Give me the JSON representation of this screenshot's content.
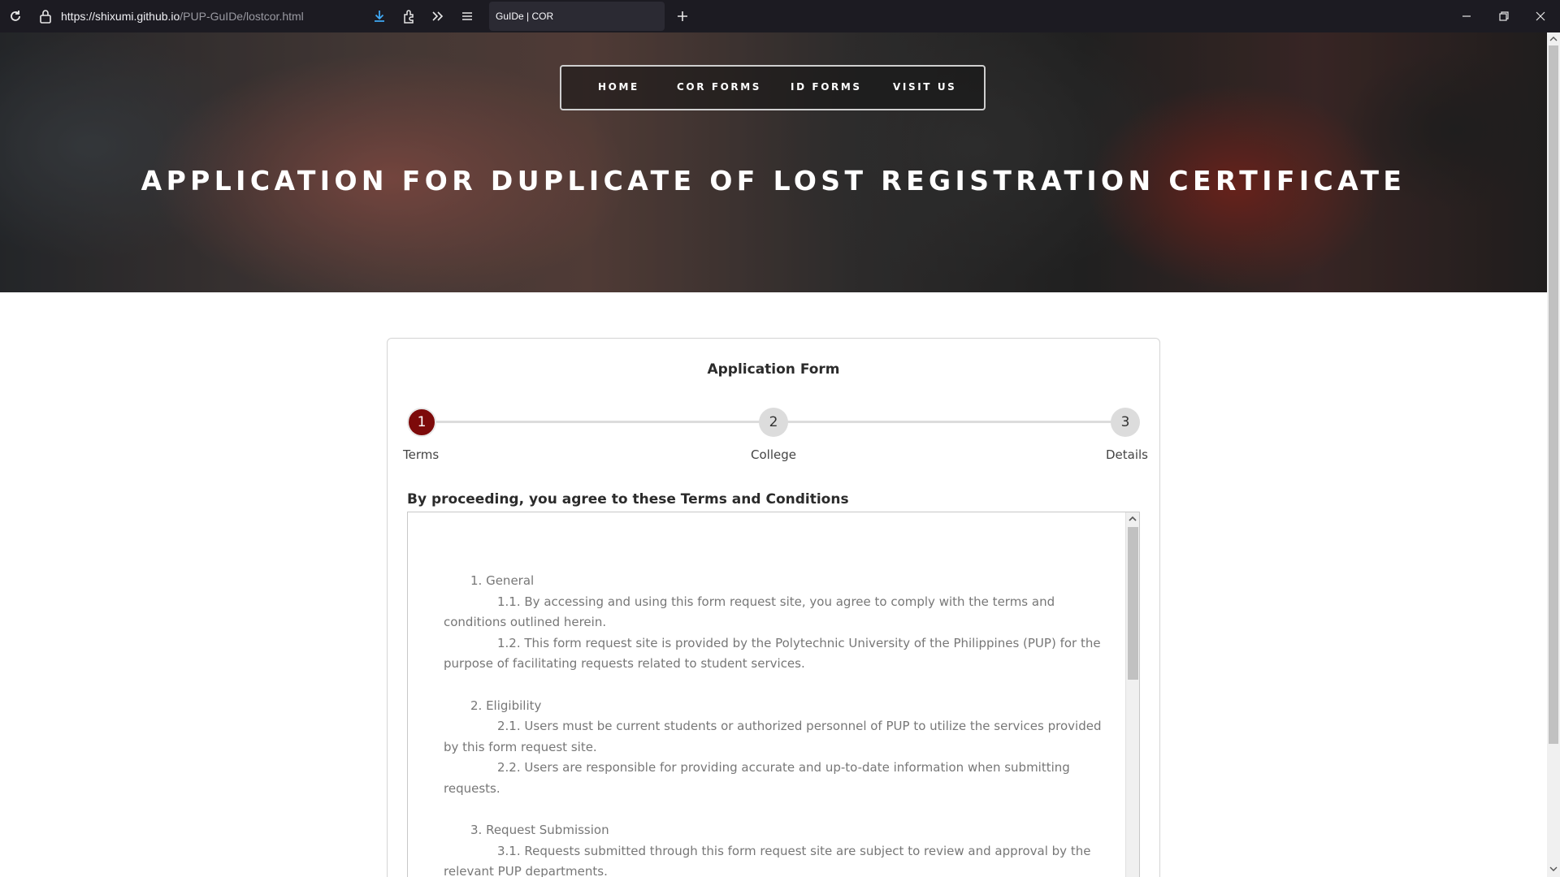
{
  "browser": {
    "url_host": "https://shixumi.github.io",
    "url_path": "/PUP-GuIDe/lostcor.html",
    "tab_title": "GuIDe | COR",
    "icons": [
      "reload-icon",
      "lock-icon",
      "download-icon",
      "extensions-icon",
      "overflow-icon",
      "menu-icon",
      "new-tab-icon",
      "minimize-icon",
      "restore-icon",
      "close-icon"
    ]
  },
  "nav": {
    "items": [
      "HOME",
      "COR FORMS",
      "ID FORMS",
      "VISIT US"
    ]
  },
  "hero": {
    "title": "APPLICATION FOR DUPLICATE OF LOST REGISTRATION CERTIFICATE"
  },
  "form": {
    "title": "Application Form",
    "steps": [
      {
        "number": "1",
        "label": "Terms",
        "active": true
      },
      {
        "number": "2",
        "label": "College",
        "active": false
      },
      {
        "number": "3",
        "label": "Details",
        "active": false
      }
    ],
    "terms_heading": "By proceeding, you agree to these Terms and Conditions",
    "terms": {
      "s1": "1. General",
      "s1_1": "1.1. By accessing and using this form request site, you agree to comply with the terms and conditions outlined herein.",
      "s1_2": "1.2. This form request site is provided by the Polytechnic University of the Philippines (PUP) for the purpose of facilitating requests related to student services.",
      "s2": "2. Eligibility",
      "s2_1": "2.1. Users must be current students or authorized personnel of PUP to utilize the services provided by this form request site.",
      "s2_2": "2.2. Users are responsible for providing accurate and up-to-date information when submitting requests.",
      "s3": "3. Request Submission",
      "s3_1": "3.1. Requests submitted through this form request site are subject to review and approval by the relevant PUP departments."
    }
  },
  "colors": {
    "active_step": "#7d0a0a",
    "inactive_step": "#dcdcdc",
    "chrome_bg": "#1c1b22",
    "download_accent": "#3fa9f5"
  }
}
